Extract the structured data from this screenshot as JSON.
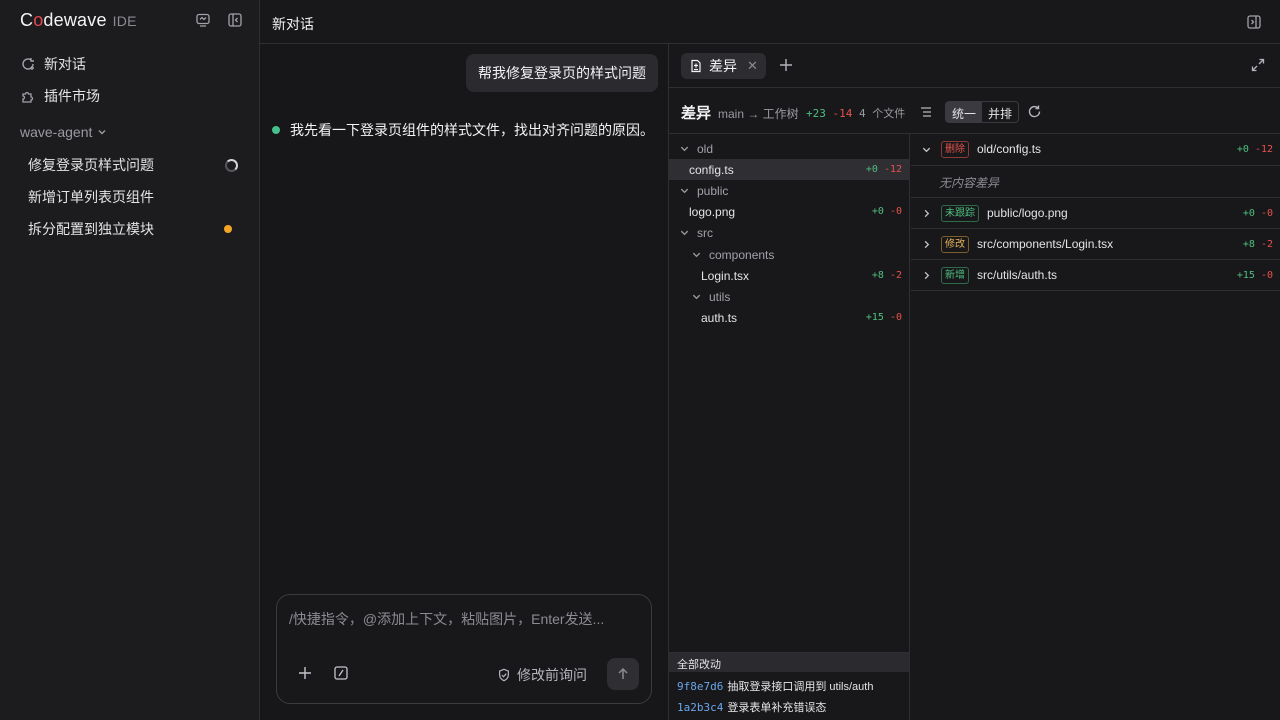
{
  "brand": {
    "name_pre": "C",
    "name_o": "o",
    "name_post": "dewave",
    "suffix": "IDE"
  },
  "sidebar": {
    "nav": [
      {
        "label": "新对话"
      },
      {
        "label": "插件市场"
      }
    ],
    "group": "wave-agent",
    "conversations": [
      {
        "label": "修复登录页样式问题",
        "status": "loading"
      },
      {
        "label": "新增订单列表页组件",
        "status": ""
      },
      {
        "label": "拆分配置到独立模块",
        "status": "unread"
      }
    ]
  },
  "header": {
    "title": "新对话"
  },
  "chat": {
    "user_message": "帮我修复登录页的样式问题",
    "assistant_message": "我先看一下登录页组件的样式文件，找出对齐问题的原因。",
    "input_placeholder": "/快捷指令，@添加上下文，粘贴图片，Enter发送...",
    "ask_label": "修改前询问"
  },
  "diff": {
    "tab_label": "差异",
    "tab_close": "✕",
    "title": "差异",
    "branch": "main → 工作树",
    "additions": "+23",
    "deletions": "-14",
    "file_count": "4 个文件",
    "view_unified": "统一",
    "view_split": "并排",
    "tree": [
      {
        "name": "old",
        "type": "folder",
        "depth": 0
      },
      {
        "name": "config.ts",
        "type": "file",
        "depth": 1,
        "add": "+0",
        "del": "-12",
        "selected": true
      },
      {
        "name": "public",
        "type": "folder",
        "depth": 0
      },
      {
        "name": "logo.png",
        "type": "file",
        "depth": 1,
        "add": "+0",
        "del": "-0"
      },
      {
        "name": "src",
        "type": "folder",
        "depth": 0
      },
      {
        "name": "components",
        "type": "folder",
        "depth": 1
      },
      {
        "name": "Login.tsx",
        "type": "file",
        "depth": 2,
        "add": "+8",
        "del": "-2"
      },
      {
        "name": "utils",
        "type": "folder",
        "depth": 1
      },
      {
        "name": "auth.ts",
        "type": "file",
        "depth": 2,
        "add": "+15",
        "del": "-0"
      }
    ],
    "files": [
      {
        "badge": "删除",
        "kind": "del",
        "path": "old/config.ts",
        "add": "+0",
        "del": "-12",
        "expanded": true,
        "note": "无内容差异"
      },
      {
        "badge": "未跟踪",
        "kind": "untracked",
        "path": "public/logo.png",
        "add": "+0",
        "del": "-0"
      },
      {
        "badge": "修改",
        "kind": "mod",
        "path": "src/components/Login.tsx",
        "add": "+8",
        "del": "-2"
      },
      {
        "badge": "新增",
        "kind": "new",
        "path": "src/utils/auth.ts",
        "add": "+15",
        "del": "-0"
      }
    ],
    "commits_header": "全部改动",
    "commits": [
      {
        "hash": "9f8e7d6",
        "msg": "抽取登录接口调用到 utils/auth"
      },
      {
        "hash": "1a2b3c4",
        "msg": "登录表单补充错误态"
      }
    ]
  },
  "colors": {
    "accent_add": "#4fbf7f",
    "accent_del": "#e5534b",
    "hash": "#6aa6e8",
    "unread_dot": "#f5a524",
    "online_dot": "#46c08a"
  }
}
